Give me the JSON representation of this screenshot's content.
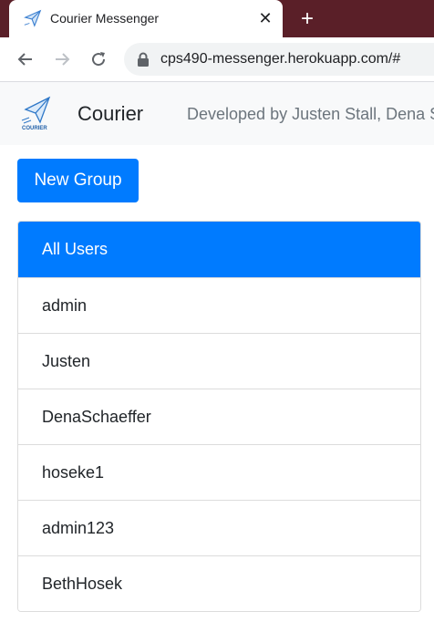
{
  "browser": {
    "tab": {
      "title": "Courier Messenger",
      "close_glyph": "✕"
    },
    "new_tab_glyph": "+",
    "url": "cps490-messenger.herokuapp.com/#"
  },
  "navbar": {
    "logo_text": "COURIER",
    "brand": "Courier",
    "credits": "Developed by Justen Stall, Dena Schaeffer"
  },
  "toolbar": {
    "new_group_label": "New Group"
  },
  "user_list": {
    "items": [
      {
        "label": "All Users",
        "active": true
      },
      {
        "label": "admin"
      },
      {
        "label": "Justen"
      },
      {
        "label": "DenaSchaeffer"
      },
      {
        "label": "hoseke1"
      },
      {
        "label": "admin123"
      },
      {
        "label": "BethHosek"
      }
    ]
  },
  "colors": {
    "primary": "#007bff",
    "tabstrip": "#5a1f28",
    "navbar_bg": "#f8f9fa",
    "muted_text": "#6c757d"
  }
}
